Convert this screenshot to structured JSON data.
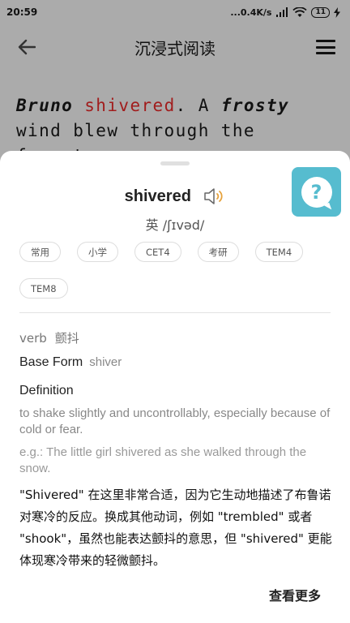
{
  "status_bar": {
    "time": "20:59",
    "network_speed": "...0.4K/s",
    "battery": "11",
    "icons": [
      "signal-icon",
      "wifi-icon",
      "battery-icon",
      "charging-icon"
    ]
  },
  "app_bar": {
    "title": "沉浸式阅读",
    "back_icon": "arrow-left-icon",
    "menu_icon": "hamburger-menu-icon"
  },
  "passage": {
    "name": "Bruno",
    "highlight": "shivered",
    "text_after_highlight": ". A ",
    "adjective": "frosty",
    "rest": " wind blew through the forest."
  },
  "word_card": {
    "word": "shivered",
    "phonetic": "英 /ʃɪvəd/",
    "tags": [
      "常用",
      "小学",
      "CET4",
      "考研",
      "TEM4",
      "TEM8"
    ],
    "part_of_speech": "verb",
    "translation": "颤抖",
    "base_form_label": "Base Form",
    "base_form_value": "shiver",
    "definition_label": "Definition",
    "definition": "to shake slightly and uncontrollably, especially because of cold or fear.",
    "example": "e.g.: The little girl shivered as she walked through the snow.",
    "explanation": "\"Shivered\" 在这里非常合适，因为它生动地描述了布鲁诺对寒冷的反应。换成其他动词，例如 \"trembled\" 或者 \"shook\"，虽然也能表达颤抖的意思，但 \"shivered\" 更能体现寒冷带来的轻微颤抖。",
    "more_button": "查看更多"
  },
  "help_button": {
    "icon": "question-mark-icon",
    "color": "#56bccf"
  },
  "colors": {
    "highlight": "#a11d1d",
    "overlay": "#ababab"
  }
}
